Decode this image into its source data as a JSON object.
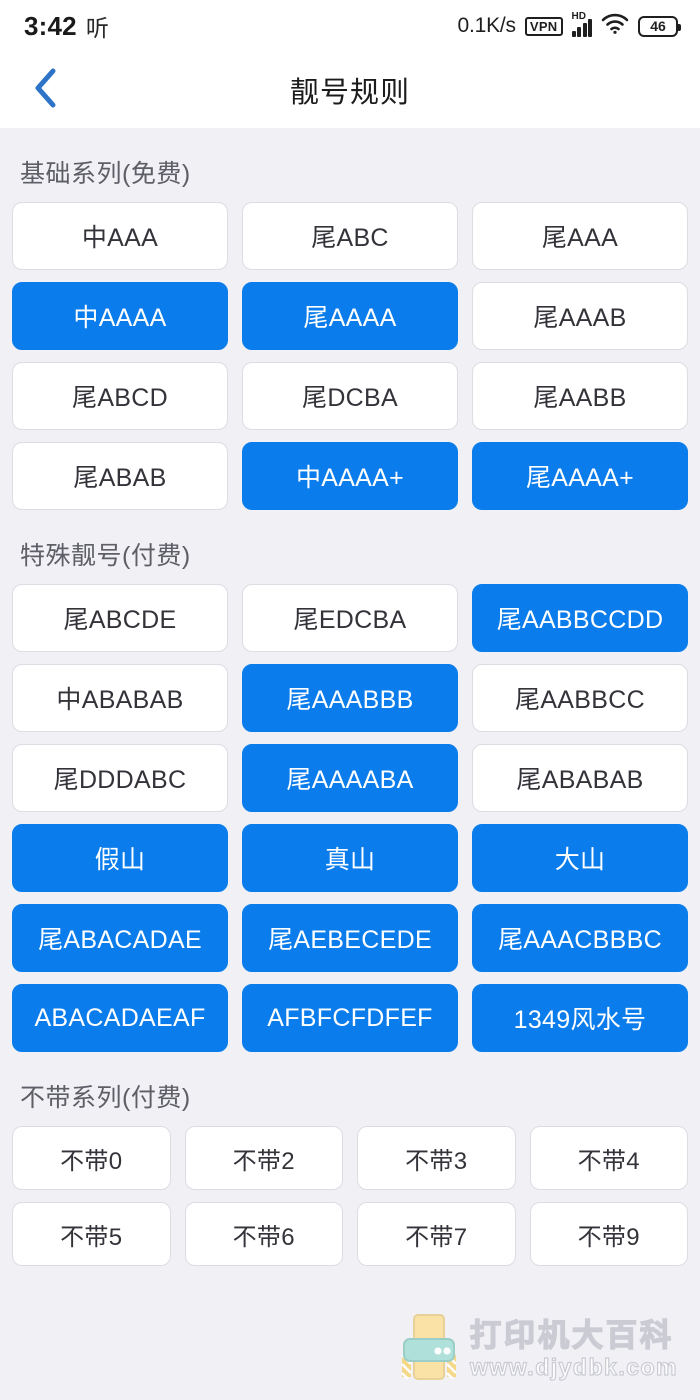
{
  "status_bar": {
    "time": "3:42",
    "listen_glyph": "听",
    "network_speed": "0.1K/s",
    "vpn_label": "VPN",
    "hd_label": "HD",
    "battery_level": "46",
    "icons": [
      "vpn-icon",
      "hd-signal-icon",
      "wifi-icon",
      "battery-icon"
    ]
  },
  "nav": {
    "back_icon": "chevron-left-icon",
    "title": "靓号规则"
  },
  "sections": [
    {
      "title": "基础系列(免费)",
      "columns": 3,
      "items": [
        {
          "label": "中AAA",
          "selected": false
        },
        {
          "label": "尾ABC",
          "selected": false
        },
        {
          "label": "尾AAA",
          "selected": false
        },
        {
          "label": "中AAAA",
          "selected": true
        },
        {
          "label": "尾AAAA",
          "selected": true
        },
        {
          "label": "尾AAAB",
          "selected": false
        },
        {
          "label": "尾ABCD",
          "selected": false
        },
        {
          "label": "尾DCBA",
          "selected": false
        },
        {
          "label": "尾AABB",
          "selected": false
        },
        {
          "label": "尾ABAB",
          "selected": false
        },
        {
          "label": "中AAAA+",
          "selected": true
        },
        {
          "label": "尾AAAA+",
          "selected": true
        }
      ]
    },
    {
      "title": "特殊靓号(付费)",
      "columns": 3,
      "items": [
        {
          "label": "尾ABCDE",
          "selected": false
        },
        {
          "label": "尾EDCBA",
          "selected": false
        },
        {
          "label": "尾AABBCCDD",
          "selected": true
        },
        {
          "label": "中ABABAB",
          "selected": false
        },
        {
          "label": "尾AAABBB",
          "selected": true
        },
        {
          "label": "尾AABBCC",
          "selected": false
        },
        {
          "label": "尾DDDABC",
          "selected": false
        },
        {
          "label": "尾AAAABA",
          "selected": true
        },
        {
          "label": "尾ABABAB",
          "selected": false
        },
        {
          "label": "假山",
          "selected": true
        },
        {
          "label": "真山",
          "selected": true
        },
        {
          "label": "大山",
          "selected": true
        },
        {
          "label": "尾ABACADAE",
          "selected": true
        },
        {
          "label": "尾AEBECEDE",
          "selected": true
        },
        {
          "label": "尾AAACBBBC",
          "selected": true
        },
        {
          "label": "ABACADAEAF",
          "selected": true
        },
        {
          "label": "AFBFCFDFEF",
          "selected": true
        },
        {
          "label": "1349风水号",
          "selected": true
        }
      ]
    },
    {
      "title": "不带系列(付费)",
      "columns": 4,
      "items": [
        {
          "label": "不带0",
          "selected": false
        },
        {
          "label": "不带2",
          "selected": false
        },
        {
          "label": "不带3",
          "selected": false
        },
        {
          "label": "不带4",
          "selected": false
        },
        {
          "label": "不带5",
          "selected": false
        },
        {
          "label": "不带6",
          "selected": false
        },
        {
          "label": "不带7",
          "selected": false
        },
        {
          "label": "不带9",
          "selected": false
        }
      ]
    }
  ],
  "watermark": {
    "icon": "printer-icon",
    "main_text": "打印机大百科",
    "sub_text": "www.djydbk.com"
  },
  "colors": {
    "accent_blue": "#0a7cec",
    "page_background": "#f0f0f5",
    "bar_background": "#ffffff",
    "chip_border": "#dcdce2",
    "section_title": "#5e5e66"
  }
}
